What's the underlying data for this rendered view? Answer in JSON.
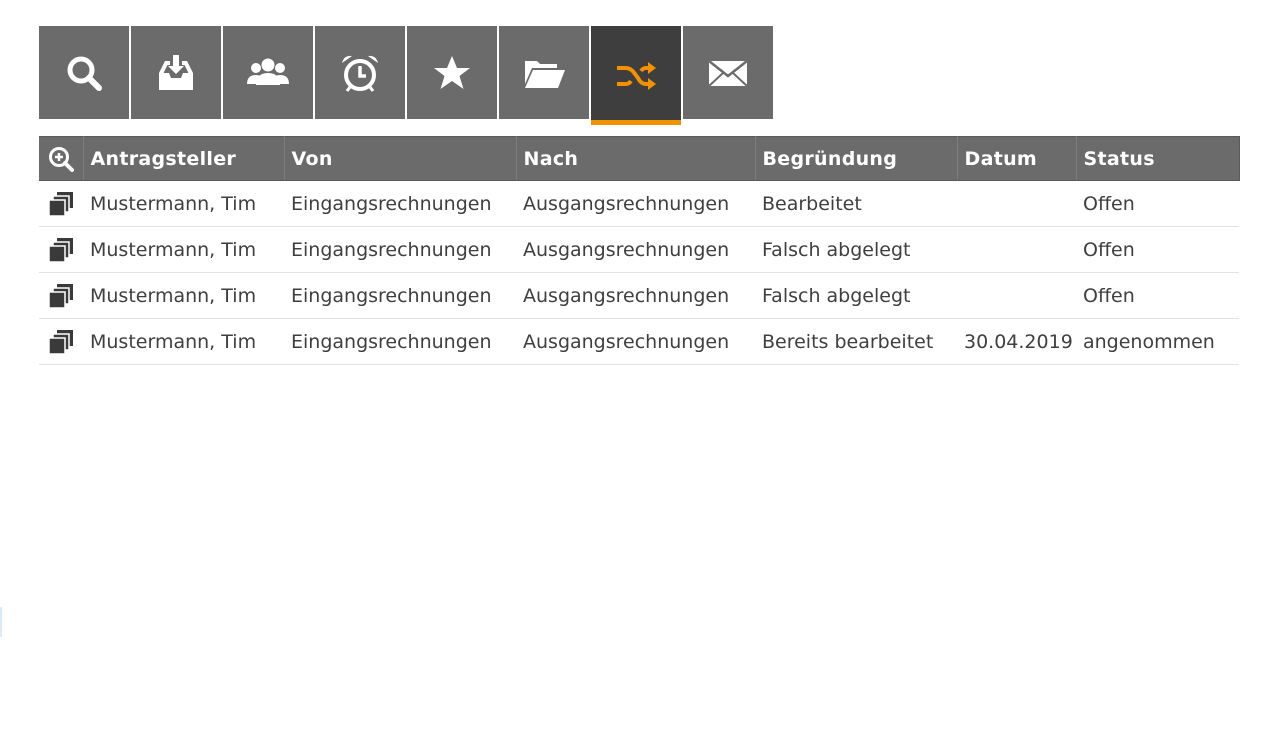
{
  "toolbar": {
    "buttons": [
      {
        "icon": "search-icon",
        "active": false
      },
      {
        "icon": "inbox-download-icon",
        "active": false
      },
      {
        "icon": "users-icon",
        "active": false
      },
      {
        "icon": "alarm-clock-icon",
        "active": false
      },
      {
        "icon": "star-icon",
        "active": false
      },
      {
        "icon": "folder-open-icon",
        "active": false
      },
      {
        "icon": "shuffle-icon",
        "active": true
      },
      {
        "icon": "envelope-icon",
        "active": false
      }
    ],
    "accent_color": "#f39200",
    "button_color": "#6b6b6b",
    "active_button_color": "#3e3e3e"
  },
  "table": {
    "header_icon": "zoom-in-icon",
    "columns": [
      "Antragsteller",
      "Von",
      "Nach",
      "Begründung",
      "Datum",
      "Status"
    ],
    "rows": [
      {
        "row_icon": "copy-documents-icon",
        "antragsteller": "Mustermann, Tim",
        "von": "Eingangsrechnungen",
        "nach": "Ausgangsrechnungen",
        "begruendung": "Bearbeitet",
        "datum": "",
        "status": "Offen"
      },
      {
        "row_icon": "copy-documents-icon",
        "antragsteller": "Mustermann, Tim",
        "von": "Eingangsrechnungen",
        "nach": "Ausgangsrechnungen",
        "begruendung": "Falsch abgelegt",
        "datum": "",
        "status": "Offen"
      },
      {
        "row_icon": "copy-documents-icon",
        "antragsteller": "Mustermann, Tim",
        "von": "Eingangsrechnungen",
        "nach": "Ausgangsrechnungen",
        "begruendung": "Falsch abgelegt",
        "datum": "",
        "status": "Offen"
      },
      {
        "row_icon": "copy-documents-icon",
        "antragsteller": "Mustermann, Tim",
        "von": "Eingangsrechnungen",
        "nach": "Ausgangsrechnungen",
        "begruendung": "Bereits bearbeitet",
        "datum": "30.04.2019",
        "status": "angenommen"
      }
    ]
  }
}
